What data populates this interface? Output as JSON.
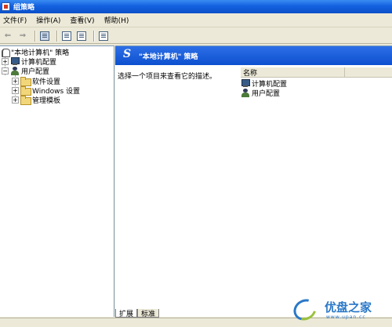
{
  "window": {
    "title": "组策略"
  },
  "menu": [
    {
      "label": "文件(F)"
    },
    {
      "label": "操作(A)"
    },
    {
      "label": "查看(V)"
    },
    {
      "label": "帮助(H)"
    }
  ],
  "toolbar": {
    "back_glyph": "⇐",
    "forward_glyph": "⇒"
  },
  "tree": {
    "root": {
      "label": "\"本地计算机\" 策略"
    },
    "computer": {
      "label": "计算机配置",
      "toggle": "+"
    },
    "user": {
      "label": "用户配置",
      "toggle": "−"
    },
    "children": [
      {
        "label": "软件设置",
        "toggle": "+"
      },
      {
        "label": "Windows 设置",
        "toggle": "+"
      },
      {
        "label": "管理模板",
        "toggle": "+"
      }
    ]
  },
  "right_pane": {
    "header_title": "\"本地计算机\" 策略",
    "description": "选择一个项目来查看它的描述。",
    "list": {
      "column_header": "名称",
      "items": [
        {
          "label": "计算机配置"
        },
        {
          "label": "用户配置"
        }
      ]
    }
  },
  "tabs": [
    {
      "label": "扩展"
    },
    {
      "label": "标准"
    }
  ],
  "watermark": {
    "brand": "优盘之家",
    "url": "www.upan.cc"
  }
}
